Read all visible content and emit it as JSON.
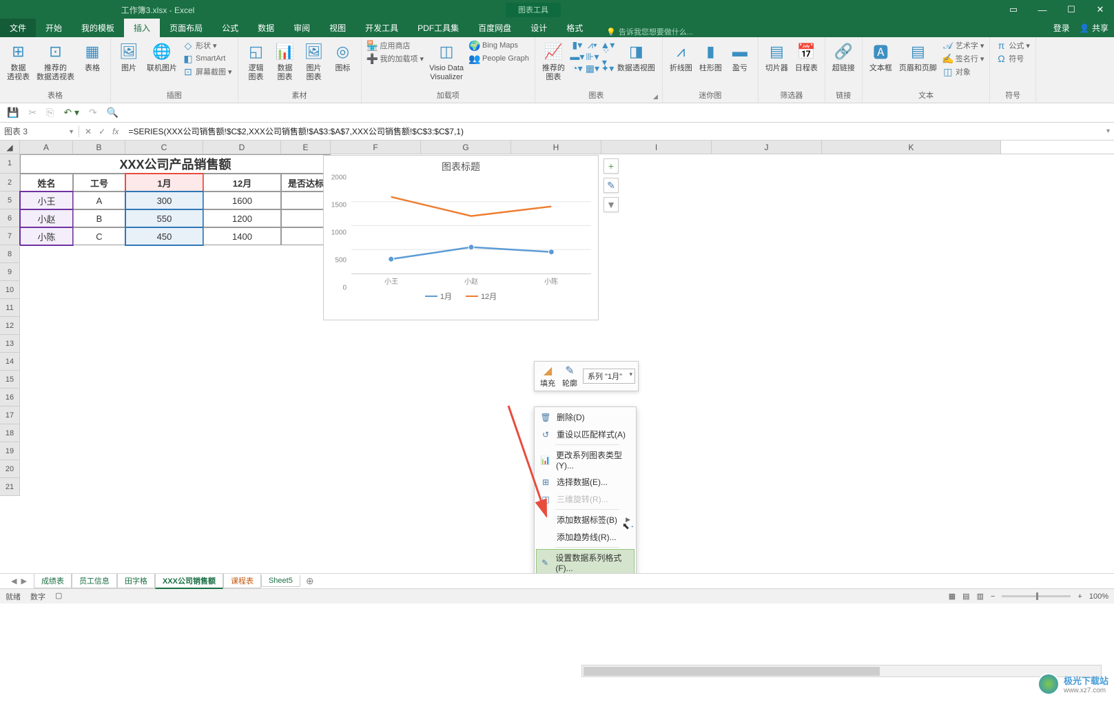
{
  "titlebar": {
    "filename": "工作簿3.xlsx - Excel",
    "chart_tools": "图表工具"
  },
  "tabs": {
    "file": "文件",
    "items": [
      "开始",
      "我的模板",
      "插入",
      "页面布局",
      "公式",
      "数据",
      "审阅",
      "视图",
      "开发工具",
      "PDF工具集",
      "百度网盘",
      "设计",
      "格式"
    ],
    "active_index": 2,
    "tell_me": "告诉我您想要做什么...",
    "login": "登录",
    "share": "共享"
  },
  "ribbon": {
    "tables": {
      "label": "表格",
      "pivot": "数据\n透视表",
      "recommended": "推荐的\n数据透视表",
      "table": "表格"
    },
    "illustrations": {
      "label": "插图",
      "pictures": "图片",
      "online_pictures": "联机图片",
      "shapes": "形状",
      "smartart": "SmartArt",
      "screenshot": "屏幕截图"
    },
    "charts_btns": {
      "column": "逻辑\n图表",
      "data": "数据\n图表",
      "times": "图片\n图表",
      "icon": "图标"
    },
    "material": {
      "label": "素材"
    },
    "addins": {
      "label": "加载项",
      "store": "应用商店",
      "my": "我的加载项",
      "visio": "Visio Data\nVisualizer",
      "bing": "Bing Maps",
      "people": "People Graph"
    },
    "charts": {
      "label": "图表",
      "recommended": "推荐的\n图表",
      "pivotchart": "数据透视图"
    },
    "sparklines": {
      "label": "迷你图",
      "line": "折线图",
      "column": "柱形图",
      "winloss": "盈亏"
    },
    "filters": {
      "label": "筛选器",
      "slicer": "切片器",
      "timeline": "日程表"
    },
    "links": {
      "label": "链接",
      "hyperlink": "超链接"
    },
    "text": {
      "label": "文本",
      "textbox": "文本框",
      "header": "页眉和页脚",
      "wordart": "艺术字",
      "sigline": "签名行",
      "object": "对象"
    },
    "symbols": {
      "label": "符号",
      "equation": "公式",
      "symbol": "符号"
    }
  },
  "formula_bar": {
    "namebox": "图表 3",
    "formula": "=SERIES(XXX公司销售额!$C$2,XXX公司销售额!$A$3:$A$7,XXX公司销售额!$C$3:$C$7,1)"
  },
  "cols": [
    "A",
    "B",
    "C",
    "D",
    "E",
    "F",
    "G",
    "H",
    "I",
    "J",
    "K"
  ],
  "table": {
    "title": "XXX公司产品销售额",
    "headers": [
      "姓名",
      "工号",
      "1月",
      "12月",
      "是否达标"
    ],
    "rows": [
      {
        "name": "小王",
        "id": "A",
        "m1": "300",
        "m12": "1600",
        "ok": ""
      },
      {
        "name": "小赵",
        "id": "B",
        "m1": "550",
        "m12": "1200",
        "ok": ""
      },
      {
        "name": "小陈",
        "id": "C",
        "m1": "450",
        "m12": "1400",
        "ok": ""
      }
    ]
  },
  "chart_data": {
    "type": "line",
    "title": "图表标题",
    "categories": [
      "小王",
      "小赵",
      "小陈"
    ],
    "series": [
      {
        "name": "1月",
        "values": [
          300,
          550,
          450
        ],
        "color": "#5b9bd5"
      },
      {
        "name": "12月",
        "values": [
          1600,
          1200,
          1400
        ],
        "color": "#ed7d31"
      }
    ],
    "ylim": [
      0,
      2000
    ],
    "yticks": [
      0,
      500,
      1000,
      1500,
      2000
    ]
  },
  "mini_toolbar": {
    "fill": "填充",
    "outline": "轮廓",
    "series_dropdown": "系列 \"1月\""
  },
  "context_menu": {
    "items": [
      {
        "icon": "🗑",
        "label": "删除(D)",
        "disabled": false,
        "arrow": false
      },
      {
        "icon": "↺",
        "label": "重设以匹配样式(A)",
        "disabled": false,
        "arrow": false
      },
      {
        "icon": "📊",
        "label": "更改系列图表类型(Y)...",
        "disabled": false,
        "arrow": false
      },
      {
        "icon": "⊞",
        "label": "选择数据(E)...",
        "disabled": false,
        "arrow": false
      },
      {
        "icon": "◫",
        "label": "三维旋转(R)...",
        "disabled": true,
        "arrow": false
      },
      {
        "icon": "",
        "label": "添加数据标签(B)",
        "disabled": false,
        "arrow": true
      },
      {
        "icon": "",
        "label": "添加趋势线(R)...",
        "disabled": false,
        "arrow": false
      },
      {
        "icon": "✎",
        "label": "设置数据系列格式(F)...",
        "disabled": false,
        "arrow": false,
        "hover": true
      }
    ]
  },
  "side_btns": {
    "plus": "+",
    "brush": "✎",
    "filter": "▼"
  },
  "sheets": {
    "tabs": [
      "成绩表",
      "员工信息",
      "田字格",
      "XXX公司销售额",
      "课程表",
      "Sheet5"
    ],
    "active_index": 3,
    "highlight_index": 4
  },
  "status": {
    "ready": "就绪",
    "count": "数字",
    "zoom": "100%"
  },
  "watermark": {
    "text": "极光下载站",
    "url": "www.xz7.com"
  }
}
